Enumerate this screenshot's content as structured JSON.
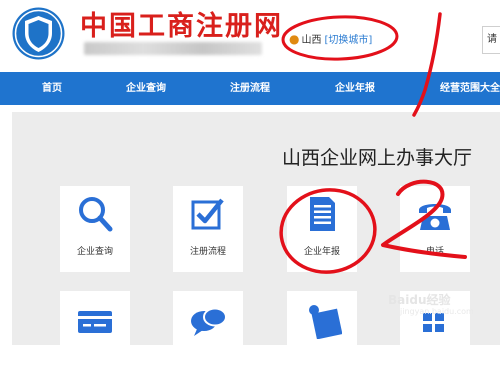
{
  "header": {
    "site_title": "中国工商注册网",
    "city": "山西",
    "switch_city": "[切换城市]",
    "search_prefix": "请"
  },
  "nav": {
    "items": [
      {
        "label": "首页"
      },
      {
        "label": "企业查询"
      },
      {
        "label": "注册流程"
      },
      {
        "label": "企业年报"
      },
      {
        "label": "经营范围大全"
      }
    ]
  },
  "main": {
    "hall_title": "山西企业网上办事大厅",
    "tiles": [
      {
        "label": "企业查询",
        "icon": "search-icon"
      },
      {
        "label": "注册流程",
        "icon": "checkbox-icon"
      },
      {
        "label": "企业年报",
        "icon": "document-icon"
      },
      {
        "label": "电话",
        "icon": "telephone-icon"
      },
      {
        "label": "",
        "icon": "card-icon"
      },
      {
        "label": "",
        "icon": "chat-bubbles-icon"
      },
      {
        "label": "",
        "icon": "pin-note-icon"
      },
      {
        "label": "",
        "icon": "grid-icon"
      }
    ]
  },
  "annotations": {
    "mark_1": "1",
    "mark_2": "2"
  },
  "watermark": {
    "text": "Baidu经验",
    "sub": "jingyan.baidu.com"
  },
  "colors": {
    "brand_red": "#d9201c",
    "nav_blue": "#1f74cf",
    "icon_blue": "#2a6fd6",
    "annotation_red": "#e3101a"
  }
}
